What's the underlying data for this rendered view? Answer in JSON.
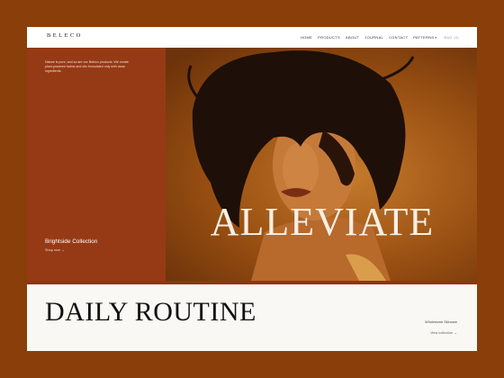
{
  "header": {
    "logo": "BELECO",
    "nav": [
      "HOME",
      "PRODUCTS",
      "ABOUT",
      "JOURNAL",
      "CONTACT",
      "PATTERNS"
    ],
    "cart": "BAG (0)"
  },
  "left_panel": {
    "intro": "Nature is pure, and so are our Beleco products. We create plant-powered balms and oils formulated only with clean ingredients.",
    "collection_title": "Brightside Collection",
    "shop_link": "Shop now →"
  },
  "hero": {
    "title": "ALLEVIATE",
    "image": "portrait-photo"
  },
  "section": {
    "title": "DAILY ROUTINE",
    "category": "Wholesome Skincare",
    "view_link": "View collection →"
  },
  "colors": {
    "outer_background": "#8a3f0a",
    "panel": "#963a16",
    "hero_tone": "#b46a22"
  }
}
